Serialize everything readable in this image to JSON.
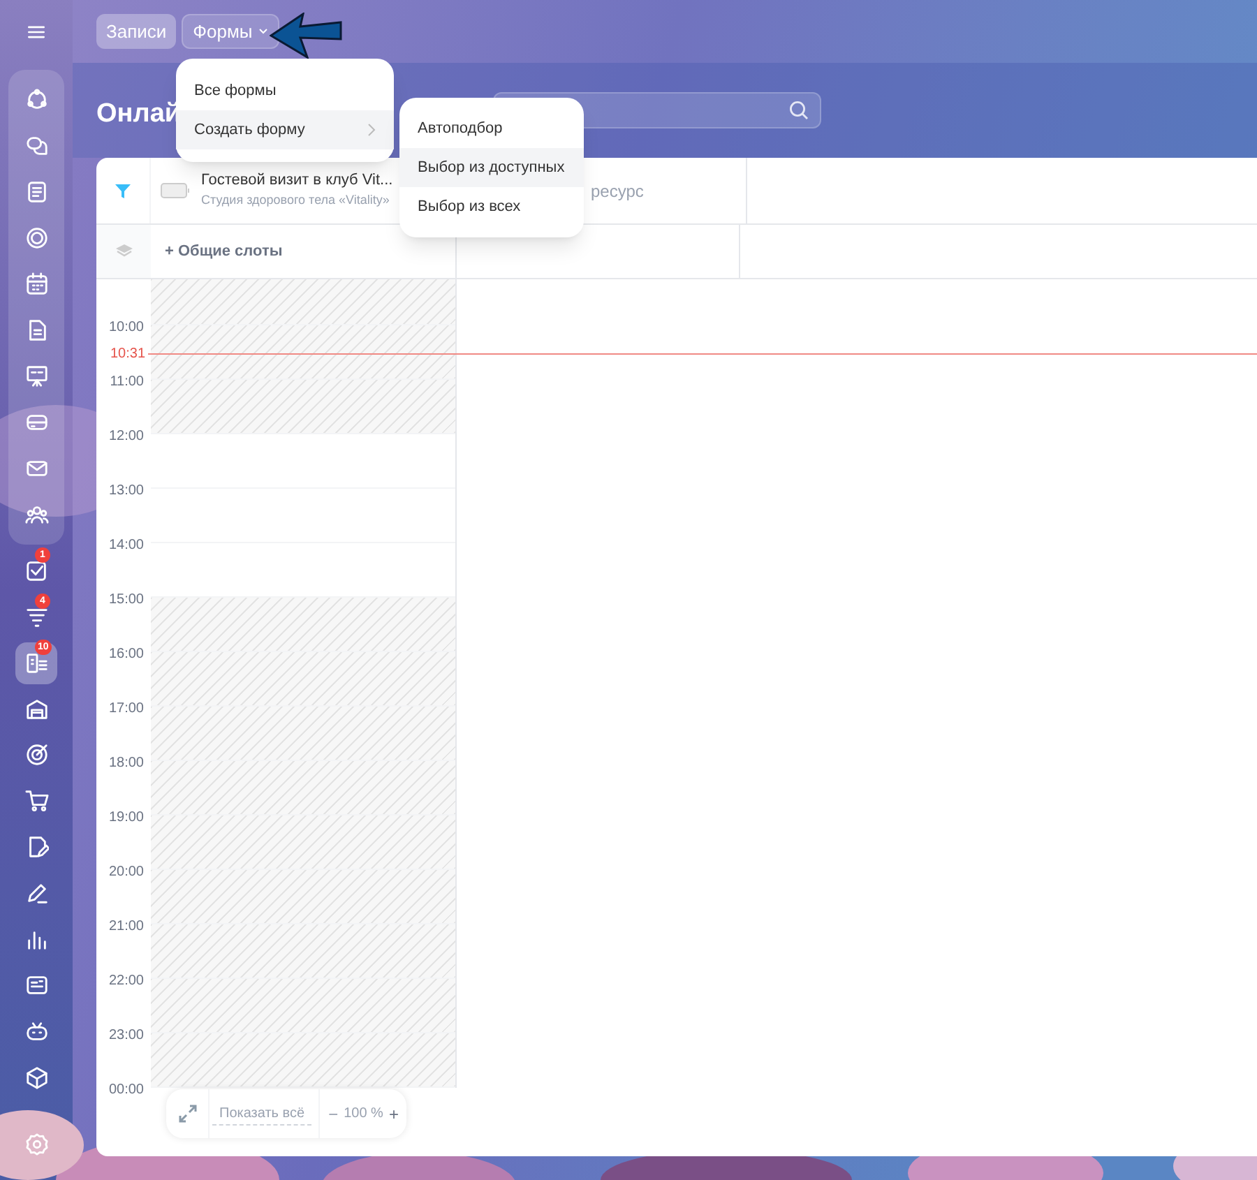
{
  "top_tabs": [
    {
      "label": "Записи",
      "selected": true,
      "dropdown": false
    },
    {
      "label": "Формы",
      "selected": false,
      "dropdown": true
    }
  ],
  "sidebar": {
    "items": [
      {
        "selected": false
      },
      {
        "selected": false
      },
      {
        "selected": false
      },
      {
        "selected": false
      },
      {
        "selected": false
      },
      {
        "selected": false
      },
      {
        "selected": false
      },
      {
        "selected": false
      },
      {
        "selected": false
      },
      {
        "selected": false
      },
      {
        "selected": false,
        "badge": "1"
      },
      {
        "selected": false,
        "badge": "4"
      },
      {
        "selected": true,
        "badge": "10"
      },
      {
        "selected": false
      },
      {
        "selected": false
      },
      {
        "selected": false
      },
      {
        "selected": false
      },
      {
        "selected": false
      },
      {
        "selected": false
      },
      {
        "selected": false
      },
      {
        "selected": false
      },
      {
        "selected": false
      }
    ]
  },
  "page_title": "Онлай",
  "menu": {
    "items": [
      {
        "label": "Все формы",
        "highlighted": false,
        "submenu": false
      },
      {
        "label": "Создать форму",
        "highlighted": true,
        "submenu": true
      }
    ]
  },
  "submenu": {
    "items": [
      {
        "label": "Автоподбор",
        "highlighted": false
      },
      {
        "label": "Выбор из доступных",
        "highlighted": true
      },
      {
        "label": "Выбор из всех",
        "highlighted": false
      }
    ]
  },
  "calendar": {
    "service_title": "Гостевой визит в клуб Vit...",
    "service_subtitle": "Студия здорового тела «Vitality»",
    "resource_column": "ресурс",
    "common_slots": "+ Общие слоты",
    "current_time": "10:31",
    "first_slot_blocked": true,
    "hours": [
      {
        "label": "10:00",
        "blocked": true
      },
      {
        "label": "11:00",
        "blocked": true
      },
      {
        "label": "12:00",
        "blocked": false
      },
      {
        "label": "13:00",
        "blocked": false
      },
      {
        "label": "14:00",
        "blocked": false
      },
      {
        "label": "15:00",
        "blocked": true
      },
      {
        "label": "16:00",
        "blocked": true
      },
      {
        "label": "17:00",
        "blocked": true
      },
      {
        "label": "18:00",
        "blocked": true
      },
      {
        "label": "19:00",
        "blocked": true
      },
      {
        "label": "20:00",
        "blocked": true
      },
      {
        "label": "21:00",
        "blocked": true
      },
      {
        "label": "22:00",
        "blocked": true
      },
      {
        "label": "23:00",
        "blocked": true
      }
    ],
    "end_label": "00:00"
  },
  "zoom_bar": {
    "show_all": "Показать всё",
    "minus": "−",
    "zoom": "100 %",
    "plus": "+"
  }
}
